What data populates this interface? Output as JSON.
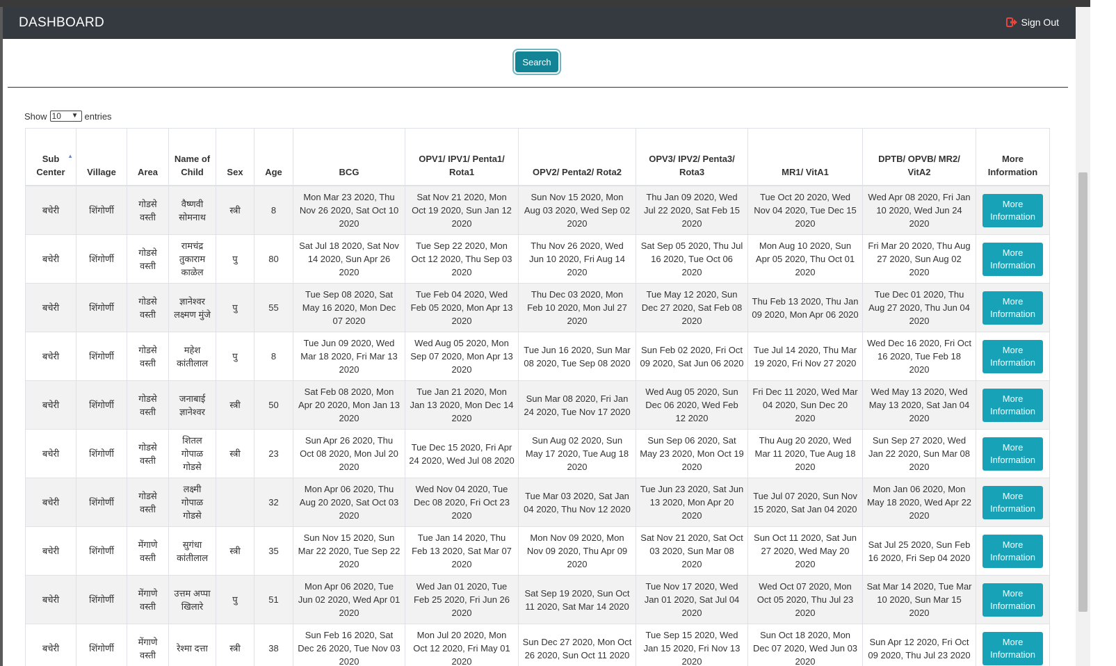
{
  "header": {
    "title": "DASHBOARD",
    "signout_label": "Sign Out"
  },
  "search": {
    "button_label": "Search"
  },
  "length_menu": {
    "show_label": "Show",
    "selected": "10",
    "entries_label": "entries"
  },
  "table": {
    "columns": [
      "Sub Center",
      "Village",
      "Area",
      "Name of Child",
      "Sex",
      "Age",
      "BCG",
      "OPV1/ IPV1/ Penta1/ Rota1",
      "OPV2/ Penta2/ Rota2",
      "OPV3/ IPV2/ Penta3/ Rota3",
      "MR1/ VitA1",
      "DPTB/ OPVB/ MR2/ VitA2",
      "More Information"
    ],
    "sorted_column": "Sub Center",
    "action_label": "More Information",
    "rows": [
      [
        "बचेरी",
        "शिंगोर्णी",
        "गोडसे वस्ती",
        "वैष्णवी सोमनाथ",
        "स्त्री",
        "8",
        "Mon Mar 23 2020, Thu Nov 26 2020, Sat Oct 10 2020",
        "Sat Nov 21 2020, Mon Oct 19 2020, Sun Jan 12 2020",
        "Sun Nov 15 2020, Mon Aug 03 2020, Wed Sep 02 2020",
        "Thu Jan 09 2020, Wed Jul 22 2020, Sat Feb 15 2020",
        "Tue Oct 20 2020, Wed Nov 04 2020, Tue Dec 15 2020",
        "Wed Apr 08 2020, Fri Jan 10 2020, Wed Jun 24 2020"
      ],
      [
        "बचेरी",
        "शिंगोर्णी",
        "गोडसे वस्ती",
        "रामचंद्र तुकाराम काळेल",
        "पु",
        "80",
        "Sat Jul 18 2020, Sat Nov 14 2020, Sun Apr 26 2020",
        "Tue Sep 22 2020, Mon Oct 12 2020, Thu Sep 03 2020",
        "Thu Nov 26 2020, Wed Jun 10 2020, Fri Aug 14 2020",
        "Sat Sep 05 2020, Thu Jul 16 2020, Tue Oct 06 2020",
        "Mon Aug 10 2020, Sun Apr 05 2020, Thu Oct 01 2020",
        "Fri Mar 20 2020, Thu Aug 27 2020, Sun Aug 02 2020"
      ],
      [
        "बचेरी",
        "शिंगोर्णी",
        "गोडसे वस्ती",
        "ज्ञानेश्वर लक्ष्मण मुंजे",
        "पु",
        "55",
        "Tue Sep 08 2020, Sat May 16 2020, Mon Dec 07 2020",
        "Tue Feb 04 2020, Wed Feb 05 2020, Mon Apr 13 2020",
        "Thu Dec 03 2020, Mon Feb 10 2020, Mon Jul 27 2020",
        "Tue May 12 2020, Sun Dec 27 2020, Sat Feb 08 2020",
        "Thu Feb 13 2020, Thu Jan 09 2020, Mon Apr 06 2020",
        "Tue Dec 01 2020, Thu Aug 27 2020, Thu Jun 04 2020"
      ],
      [
        "बचेरी",
        "शिंगोर्णी",
        "गोडसे वस्ती",
        "महेश कांतीलाल",
        "पु",
        "8",
        "Tue Jun 09 2020, Wed Mar 18 2020, Fri Mar 13 2020",
        "Wed Aug 05 2020, Mon Sep 07 2020, Mon Apr 13 2020",
        "Tue Jun 16 2020, Sun Mar 08 2020, Tue Sep 08 2020",
        "Sun Feb 02 2020, Fri Oct 09 2020, Sat Jun 06 2020",
        "Tue Jul 14 2020, Thu Mar 19 2020, Fri Nov 27 2020",
        "Wed Dec 16 2020, Fri Oct 16 2020, Tue Feb 18 2020"
      ],
      [
        "बचेरी",
        "शिंगोर्णी",
        "गोडसे वस्ती",
        "जनाबाई ज्ञानेश्वर",
        "स्त्री",
        "50",
        "Sat Feb 08 2020, Mon Apr 20 2020, Mon Jan 13 2020",
        "Tue Jan 21 2020, Mon Jan 13 2020, Mon Dec 14 2020",
        "Sun Mar 08 2020, Fri Jan 24 2020, Tue Nov 17 2020",
        "Wed Aug 05 2020, Sun Dec 06 2020, Wed Feb 12 2020",
        "Fri Dec 11 2020, Wed Mar 04 2020, Sun Dec 20 2020",
        "Wed May 13 2020, Wed May 13 2020, Sat Jan 04 2020"
      ],
      [
        "बचेरी",
        "शिंगोर्णी",
        "गोडसे वस्ती",
        "शितल गोपाळ गोडसे",
        "स्त्री",
        "23",
        "Sun Apr 26 2020, Thu Oct 08 2020, Mon Jul 20 2020",
        "Tue Dec 15 2020, Fri Apr 24 2020, Wed Jul 08 2020",
        "Sun Aug 02 2020, Sun May 17 2020, Tue Aug 18 2020",
        "Sun Sep 06 2020, Sat May 23 2020, Mon Oct 19 2020",
        "Thu Aug 20 2020, Wed Mar 11 2020, Tue Aug 18 2020",
        "Sun Sep 27 2020, Wed Jan 22 2020, Sun Mar 08 2020"
      ],
      [
        "बचेरी",
        "शिंगोर्णी",
        "गोडसे वस्ती",
        "लक्ष्मी गोपाळ गोडसे",
        "",
        "32",
        "Mon Apr 06 2020, Thu Aug 20 2020, Sat Oct 03 2020",
        "Wed Nov 04 2020, Tue Dec 08 2020, Fri Oct 23 2020",
        "Tue Mar 03 2020, Sat Jan 04 2020, Thu Nov 12 2020",
        "Tue Jun 23 2020, Sat Jun 13 2020, Mon Apr 20 2020",
        "Tue Jul 07 2020, Sun Nov 15 2020, Sat Jan 04 2020",
        "Mon Jan 06 2020, Mon May 18 2020, Wed Apr 22 2020"
      ],
      [
        "बचेरी",
        "शिंगोर्णी",
        "मेंगाणे वस्ती",
        "सुगंधा कांतीलाल",
        "स्त्री",
        "35",
        "Sun Nov 15 2020, Sun Mar 22 2020, Tue Sep 22 2020",
        "Tue Jan 14 2020, Thu Feb 13 2020, Sat Mar 07 2020",
        "Mon Nov 09 2020, Mon Nov 09 2020, Thu Apr 09 2020",
        "Sat Nov 21 2020, Sat Oct 03 2020, Sun Mar 08 2020",
        "Sun Oct 11 2020, Sat Jun 27 2020, Wed May 20 2020",
        "Sat Jul 25 2020, Sun Feb 16 2020, Fri Sep 04 2020"
      ],
      [
        "बचेरी",
        "शिंगोर्णी",
        "मेंगाणे वस्ती",
        "उत्तम अप्पा खिलारे",
        "पु",
        "51",
        "Mon Apr 06 2020, Tue Jun 02 2020, Wed Apr 01 2020",
        "Wed Jan 01 2020, Tue Feb 25 2020, Fri Jun 26 2020",
        "Sat Sep 19 2020, Sun Oct 11 2020, Sat Mar 14 2020",
        "Tue Nov 17 2020, Wed Jan 01 2020, Sat Jul 04 2020",
        "Wed Oct 07 2020, Mon Oct 05 2020, Thu Jul 23 2020",
        "Sat Mar 14 2020, Tue Mar 10 2020, Sun Mar 15 2020"
      ],
      [
        "बचेरी",
        "शिंगोर्णी",
        "मेंगाणे वस्ती",
        "रेश्मा दत्ता",
        "स्त्री",
        "38",
        "Sun Feb 16 2020, Sat Dec 26 2020, Tue Nov 03 2020",
        "Mon Jul 20 2020, Mon Oct 12 2020, Fri May 01 2020",
        "Sun Dec 27 2020, Mon Oct 26 2020, Sun Oct 11 2020",
        "Tue Sep 15 2020, Wed Jan 15 2020, Fri Nov 13 2020",
        "Sun Oct 18 2020, Mon Dec 07 2020, Wed Jun 03 2020",
        "Sun Apr 12 2020, Fri Oct 09 2020, Thu Jul 23 2020"
      ]
    ]
  }
}
